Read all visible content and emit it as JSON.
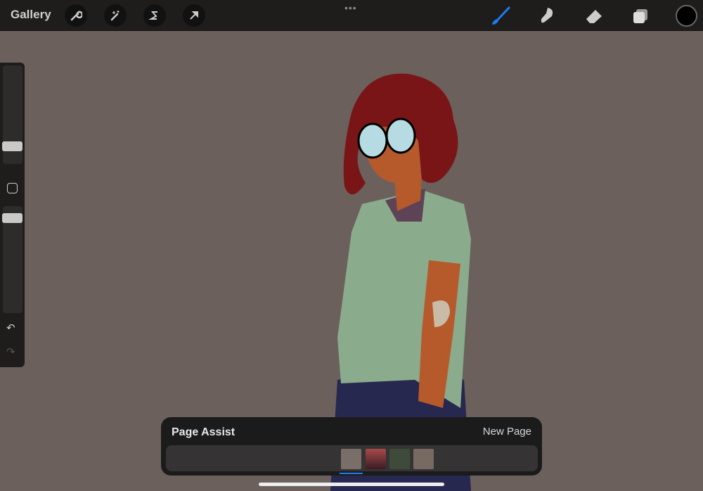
{
  "topbar": {
    "gallery_label": "Gallery",
    "more_icon": "•••",
    "left_tools": [
      "wrench-icon",
      "magic-wand-icon",
      "selection-icon",
      "transform-arrow-icon"
    ],
    "right_tools": [
      "brush-icon",
      "smudge-icon",
      "eraser-icon",
      "layers-icon"
    ],
    "accent": "#1a7cf5",
    "current_color": "#000000"
  },
  "page_assist": {
    "title": "Page Assist",
    "new_page_label": "New Page",
    "selected_page": 1,
    "pages": [
      {
        "name": "page-1"
      },
      {
        "name": "page-2"
      },
      {
        "name": "page-3"
      },
      {
        "name": "page-4"
      }
    ]
  }
}
